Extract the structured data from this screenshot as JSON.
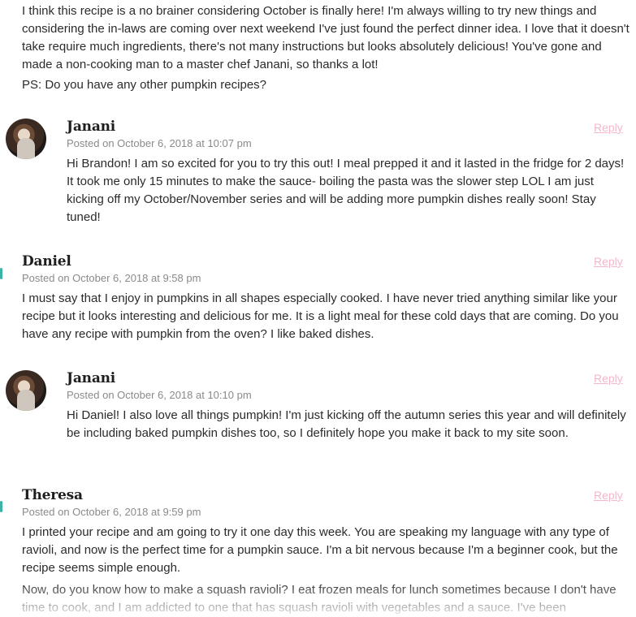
{
  "top_comment": {
    "body": "I think this recipe is a no brainer considering October is finally here! I'm always willing to try new things and considering the in-laws are coming over next weekend I've just found the perfect dinner idea. I love that it doesn't take require much ingredients, there's not many instructions but looks absolutely delicious! You've gone and made a non-cooking man to a master chef Janani, so thanks a lot!",
    "ps": "PS: Do you have any other pumpkin recipes?"
  },
  "comments": [
    {
      "author": "Janani",
      "meta": "Posted on October 6, 2018 at 10:07 pm",
      "reply": "Reply",
      "body": "Hi Brandon! I am so excited for you to try this out! I meal prepped it and it lasted in the fridge for 2 days! It took me only 15 minutes to make the sauce- boiling the pasta was the slower step LOL I am just kicking off my October/November series and will be adding more pumpkin dishes really soon! Stay tuned!"
    },
    {
      "author": "Daniel",
      "meta": "Posted on October 6, 2018 at 9:58 pm",
      "reply": "Reply",
      "body": "I must say that I enjoy in pumpkins in all shapes especially cooked. I have never tried anything similar like your recipe but it looks interesting and delicious for me. It is a light meal for these cold days that are coming. Do you have any recipe with pumpkin from the oven? I like baked dishes."
    },
    {
      "author": "Janani",
      "meta": "Posted on October 6, 2018 at 10:10 pm",
      "reply": "Reply",
      "body": "Hi Daniel! I also love all things pumpkin! I'm just kicking off the autumn series this year and will definitely be including baked pumpkin dishes too, so I definitely hope you make it back to my site soon."
    },
    {
      "author": "Theresa",
      "meta": "Posted on October 6, 2018 at 9:59 pm",
      "reply": "Reply",
      "body": "I printed your recipe and am going to try it one day this week. You are speaking my language with any type of ravioli, and now is the perfect time for a pumpkin sauce. I'm a bit nervous because I'm a beginner cook, but the recipe seems simple enough.",
      "body2": "Now, do you know how to make a squash ravioli? I eat frozen meals for lunch sometimes because I don't have time to cook, and I am addicted to one that has squash ravioli with vegetables and a sauce. I've been"
    }
  ]
}
